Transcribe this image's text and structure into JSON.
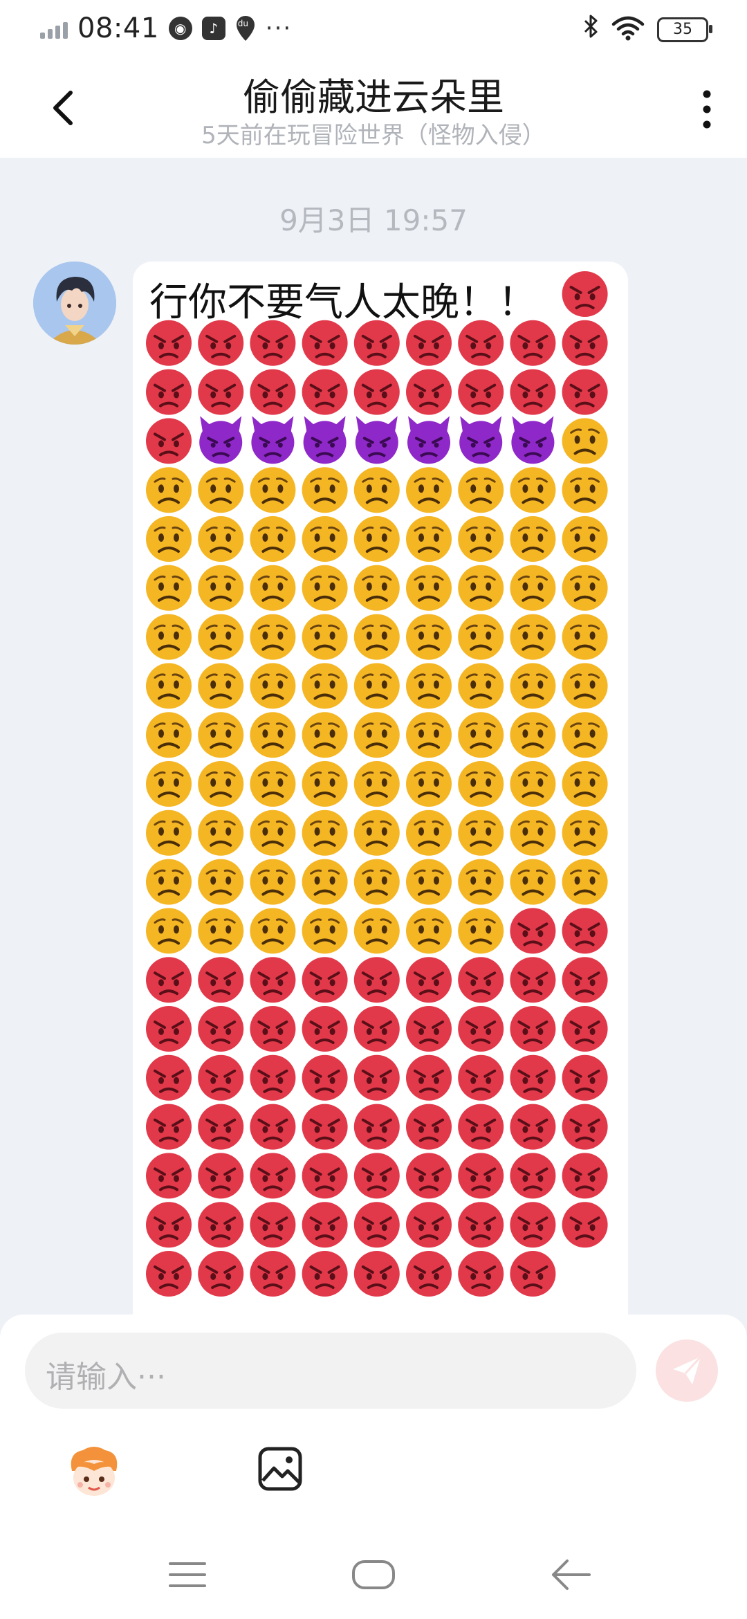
{
  "status_bar": {
    "time": "08:41",
    "icons": [
      "signal-icon",
      "compass-icon",
      "music-icon",
      "location-du-icon",
      "more-dots-icon",
      "bluetooth-icon",
      "wifi-icon",
      "battery-icon"
    ],
    "notification_du": "du",
    "dots": "···",
    "battery_level": "35"
  },
  "header": {
    "title": "偷偷藏进云朵里",
    "subtitle": "5天前在玩冒险世界（怪物入侵）",
    "icons": [
      "back-arrow-icon",
      "more-vertical-icon"
    ]
  },
  "chat": {
    "date": "9月3日 19:57",
    "message_text": "行你不要气人太晚！！",
    "emoji_sequence": [
      {
        "emoji": "pouting-face",
        "count": 20
      },
      {
        "emoji": "smiling-face-with-horns",
        "count": 7
      },
      {
        "emoji": "worried-face",
        "count": 89
      },
      {
        "emoji": "pouting-face",
        "count": 64
      }
    ],
    "colors": {
      "pouting": "#e2394a",
      "devil": "#8f28c9",
      "worried": "#f5b624"
    }
  },
  "composer": {
    "placeholder": "请输入···",
    "send_icon": "paper-plane-icon",
    "tools": [
      "sticker-face-icon",
      "image-icon"
    ],
    "accent": "#f36b6b"
  },
  "nav_bar": {
    "icons": [
      "menu-icon",
      "home-icon",
      "back-icon"
    ]
  }
}
